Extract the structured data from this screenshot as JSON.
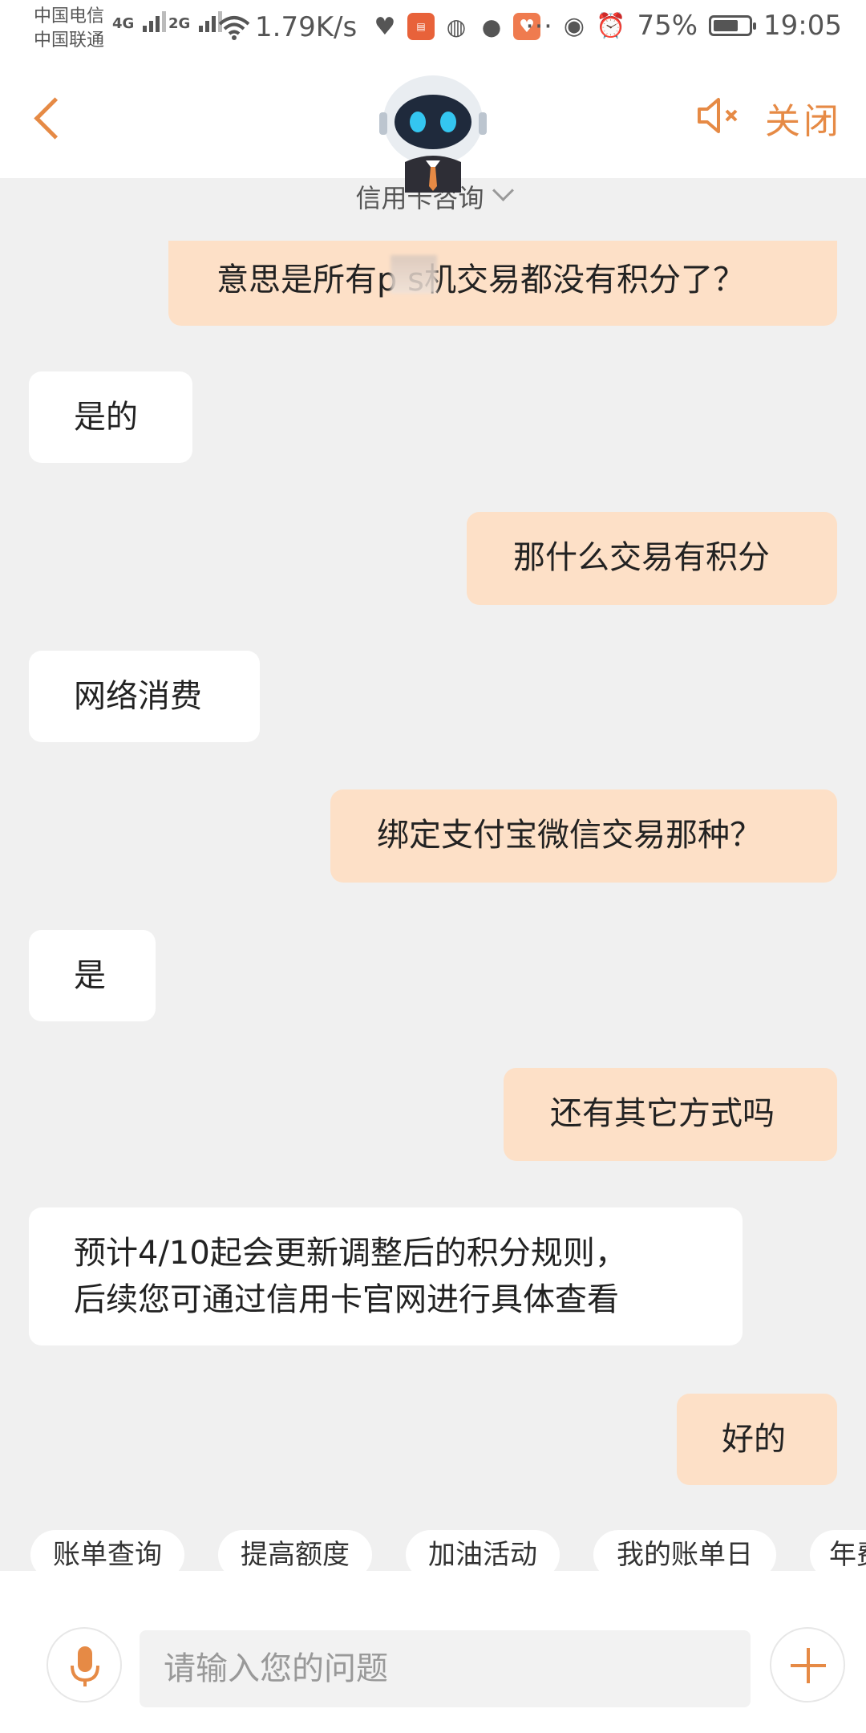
{
  "status_bar": {
    "carrier_1": "中国电信",
    "carrier_2": "中国联通",
    "signal_1": "4G",
    "signal_2": "2G",
    "net_speed": "1.79K/s",
    "battery": "75%",
    "time": "19:05",
    "icons": [
      "wifi-icon",
      "heart-pulse-icon",
      "app-icon",
      "wechat-icon",
      "chat-icon",
      "heart-app-icon",
      "more-icon",
      "eye-icon",
      "alarm-icon",
      "battery-icon"
    ]
  },
  "header": {
    "title": "信用卡咨询",
    "close_label": "关闭",
    "accent_color": "#e68a45"
  },
  "messages": [
    {
      "role": "user",
      "text": "意思是所有p   s机交易都没有积分了？"
    },
    {
      "role": "bot",
      "text": "是的"
    },
    {
      "role": "user",
      "text": "那什么交易有积分"
    },
    {
      "role": "bot",
      "text": "网络消费"
    },
    {
      "role": "user",
      "text": "绑定支付宝微信交易那种？"
    },
    {
      "role": "bot",
      "text": "是"
    },
    {
      "role": "user",
      "text": "还有其它方式吗"
    },
    {
      "role": "bot",
      "text_line1": "预计4/10起会更新调整后的积分规则，",
      "text_line2": "后续您可通过信用卡官网进行具体查看"
    },
    {
      "role": "user",
      "text": "好的"
    }
  ],
  "quick_replies": [
    "账单查询",
    "提高额度",
    "加油活动",
    "我的账单日",
    "年费"
  ],
  "input": {
    "placeholder": "请输入您的问题"
  }
}
